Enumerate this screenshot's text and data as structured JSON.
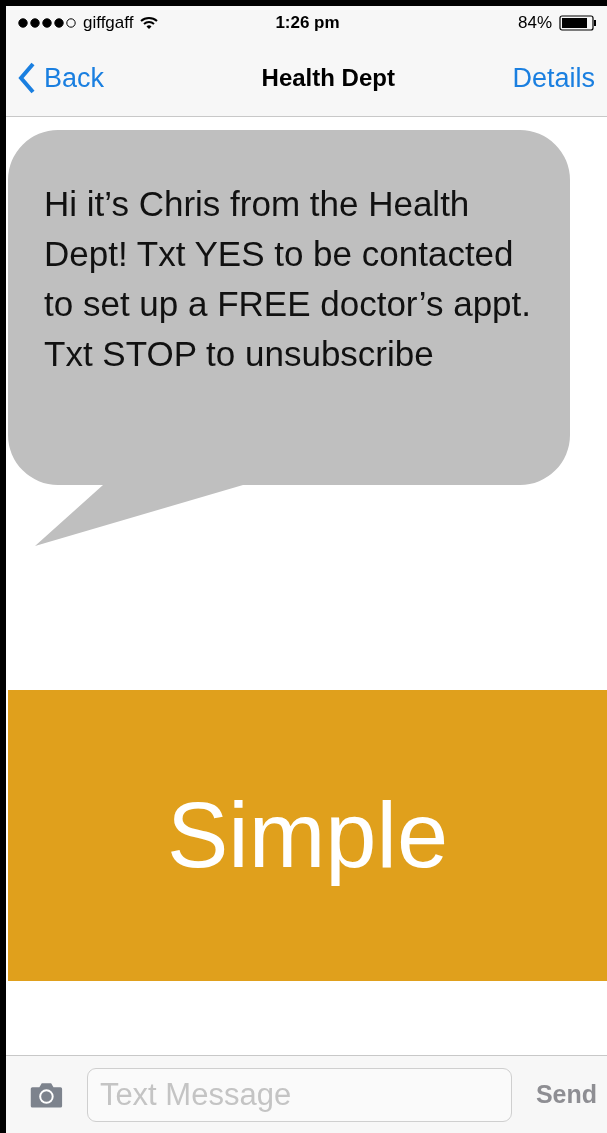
{
  "status_bar": {
    "carrier": "giffgaff",
    "time": "1:26 pm",
    "battery": "84%"
  },
  "nav": {
    "back": "Back",
    "title": "Health Dept",
    "action": "Details"
  },
  "message": {
    "text": "Hi it’s Chris from the Health Dept! Txt YES to be contacted to set up a FREE doctor’s appt. Txt STOP to unsubscribe"
  },
  "banner": {
    "text": "Simple"
  },
  "composer": {
    "placeholder": "Text Message",
    "send": "Send"
  }
}
